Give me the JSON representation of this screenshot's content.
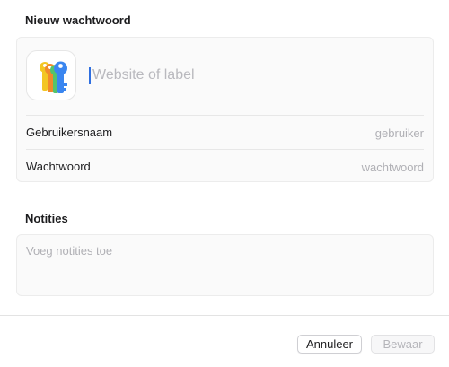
{
  "form": {
    "title": "Nieuw wachtwoord",
    "label_placeholder": "Website of label",
    "username": {
      "label": "Gebruikersnaam",
      "placeholder": "gebruiker"
    },
    "password": {
      "label": "Wachtwoord",
      "placeholder": "wachtwoord"
    }
  },
  "notes": {
    "title": "Notities",
    "placeholder": "Voeg notities toe"
  },
  "footer": {
    "cancel_label": "Annuleer",
    "save_label": "Bewaar",
    "save_enabled": false
  },
  "icon": {
    "name": "passwords-keys-icon",
    "colors": [
      "#f3c623",
      "#f08a2c",
      "#54c46b",
      "#3a86f0"
    ]
  }
}
